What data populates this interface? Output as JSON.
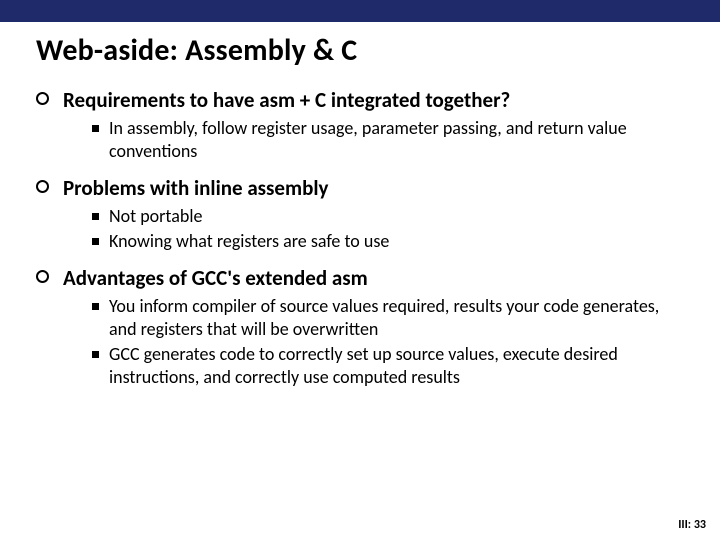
{
  "title": "Web-aside: Assembly & C",
  "sections": [
    {
      "heading": "Requirements to have asm + C integrated together?",
      "items": [
        "In assembly, follow register usage, parameter passing, and return value conventions"
      ]
    },
    {
      "heading": "Problems with inline assembly",
      "items": [
        "Not portable",
        "Knowing what registers are safe to use"
      ]
    },
    {
      "heading": "Advantages of GCC's extended asm",
      "items": [
        "You inform compiler of source values required, results your code generates, and registers that will be overwritten",
        "GCC generates code to correctly set up source values, execute desired instructions, and correctly use computed results"
      ]
    }
  ],
  "footer": "III: 33"
}
